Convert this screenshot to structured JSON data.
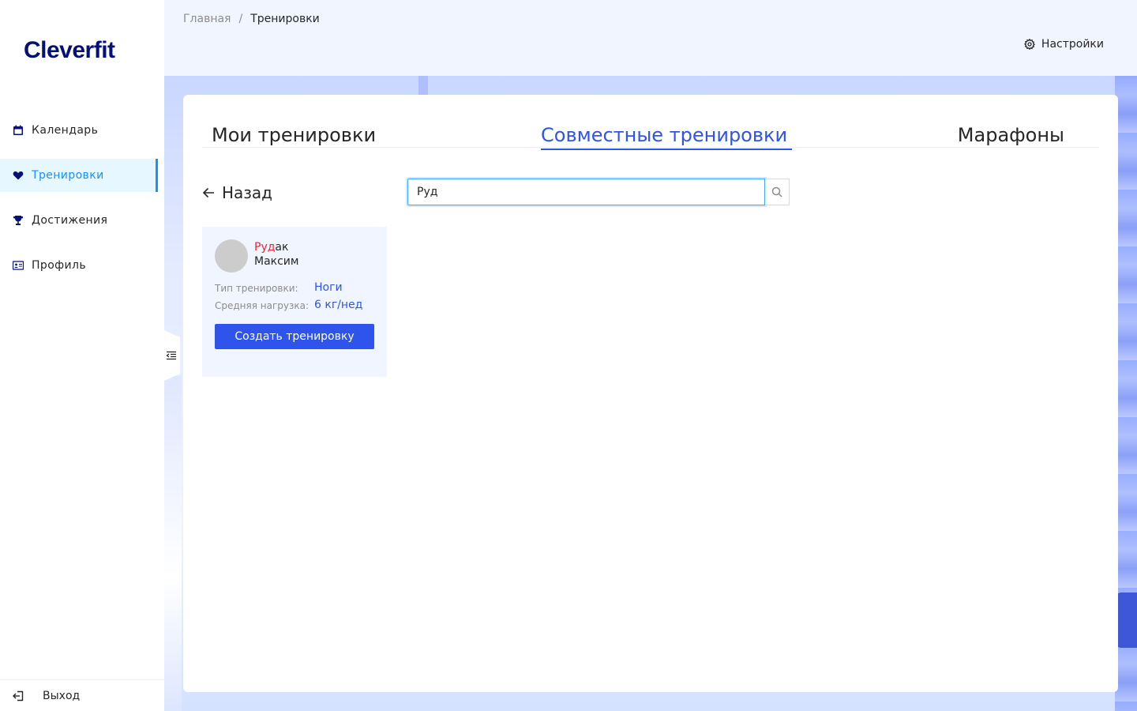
{
  "sidebar": {
    "logo": "Cleverfit",
    "items": [
      {
        "label": "Календарь",
        "icon": "calendar-icon"
      },
      {
        "label": "Тренировки",
        "icon": "heart-icon",
        "active": true
      },
      {
        "label": "Достижения",
        "icon": "trophy-icon"
      },
      {
        "label": "Профиль",
        "icon": "id-card-icon"
      }
    ],
    "logout": "Выход"
  },
  "header": {
    "breadcrumb": {
      "home": "Главная",
      "separator": "/",
      "current": "Тренировки"
    },
    "settings": "Настройки"
  },
  "tabs": [
    {
      "label": "Мои тренировки"
    },
    {
      "label": "Совместные тренировки",
      "active": true
    },
    {
      "label": "Марафоны"
    }
  ],
  "back": {
    "label": "Назад"
  },
  "search": {
    "value": "Руд"
  },
  "partner": {
    "name_highlight": "Руд",
    "name_rest": "ак",
    "name_line2": "Максим",
    "training_type_label": "Тип тренировки:",
    "training_type_value": "Ноги",
    "avg_load_label": "Средняя нагрузка:",
    "avg_load_value": "6 кг/нед",
    "create_button": "Создать тренировку"
  },
  "colors": {
    "brand": "#061178",
    "primary": "#2f54eb",
    "active_nav_bg": "#e6f7ff",
    "active_nav_text": "#1890ff",
    "highlight": "#f5222d"
  }
}
